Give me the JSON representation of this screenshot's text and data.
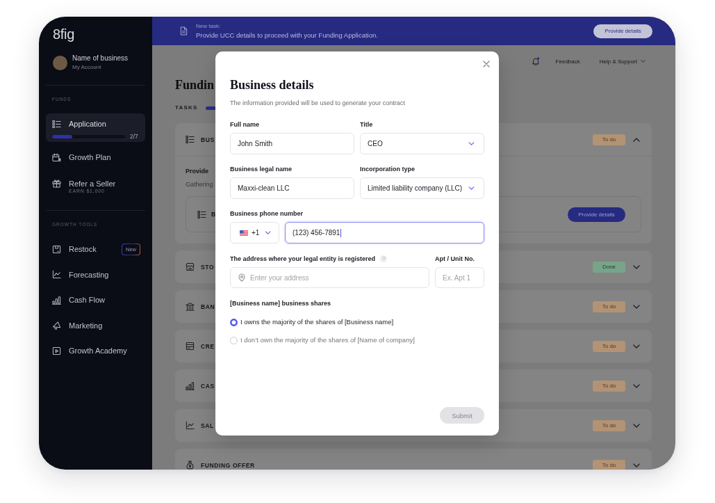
{
  "sidebar": {
    "logo": "8fig",
    "account": {
      "name": "Name of business",
      "subtitle": "My Account"
    },
    "sections": [
      {
        "heading": "FUNDS",
        "items": [
          {
            "label": "Application",
            "selected": true,
            "progress": {
              "level": 0.28,
              "reading": "2/7"
            }
          },
          {
            "label": "Growth Plan",
            "selected": false
          },
          {
            "label": "Refer a Seller",
            "caption": "EARN $1,000",
            "selected": false
          }
        ]
      },
      {
        "heading": "GROWTH TOOLS",
        "items": [
          {
            "label": "Restock",
            "badge": "New",
            "selected": false
          },
          {
            "label": "Forecasting",
            "selected": false
          },
          {
            "label": "Cash Flow",
            "selected": false
          },
          {
            "label": "Marketing",
            "selected": false
          },
          {
            "label": "Growth Academy",
            "selected": false
          }
        ]
      }
    ]
  },
  "banner": {
    "label": "New task:",
    "message": "Provide UCC details to proceed with your Funding Application.",
    "button": "Provide details"
  },
  "header": {
    "notification": true,
    "links": [
      {
        "label": "Feedback",
        "dropdown": false
      },
      {
        "label": "Help & Support",
        "dropdown": true
      }
    ]
  },
  "page": {
    "title": "Fundin",
    "section": "TASKS"
  },
  "tasks": [
    {
      "title": "BUS",
      "status": {
        "label": "To do",
        "done": false
      },
      "expanded": true,
      "details": {
        "heading": "Provide",
        "text": "Gathering",
        "item": {
          "title": "B",
          "button": "Provide details"
        }
      }
    },
    {
      "title": "STO",
      "status": {
        "label": "Done",
        "done": true
      },
      "expanded": false
    },
    {
      "title": "BAN",
      "status": {
        "label": "To do",
        "done": false
      },
      "expanded": false
    },
    {
      "title": "CRE",
      "status": {
        "label": "To do",
        "done": false
      },
      "expanded": false
    },
    {
      "title": "CAS",
      "status": {
        "label": "To do",
        "done": false
      },
      "expanded": false
    },
    {
      "title": "SAL",
      "status": {
        "label": "To do",
        "done": false
      },
      "expanded": false
    },
    {
      "title": "FUNDING OFFER",
      "status": {
        "label": "To do",
        "done": false
      },
      "expanded": false
    }
  ],
  "modal": {
    "title": "Business details",
    "subtitle": "The information provided will be used to generate your contract",
    "fields": [
      {
        "kind": "text",
        "label": "Full name",
        "value": "John Smith"
      },
      {
        "kind": "select",
        "label": "Title",
        "value": "CEO"
      },
      {
        "kind": "text",
        "label": "Business legal name",
        "value": "Maxxi-clean LLC"
      },
      {
        "kind": "select",
        "label": "Incorporation type",
        "value": "Limited liability company (LLC)"
      }
    ],
    "phone": {
      "label": "Business phone number",
      "country_code": "+1",
      "value": "(123) 456-7891",
      "focused": true
    },
    "address": {
      "label": "The address where your legal entity is registered",
      "help": "?",
      "placeholder": "Enter your address"
    },
    "apartment": {
      "label": "Apt / Unit No.",
      "placeholder": "Ex. Apt 1"
    },
    "shares": {
      "label": "[Business name] business shares",
      "options": [
        {
          "label": "I owns the majority of the shares of [Business name]",
          "selected": true
        },
        {
          "label": "I don’t own the majority of the shares of [Name of company]",
          "selected": false
        }
      ]
    },
    "submit": {
      "label": "Submit",
      "disabled": true
    }
  }
}
